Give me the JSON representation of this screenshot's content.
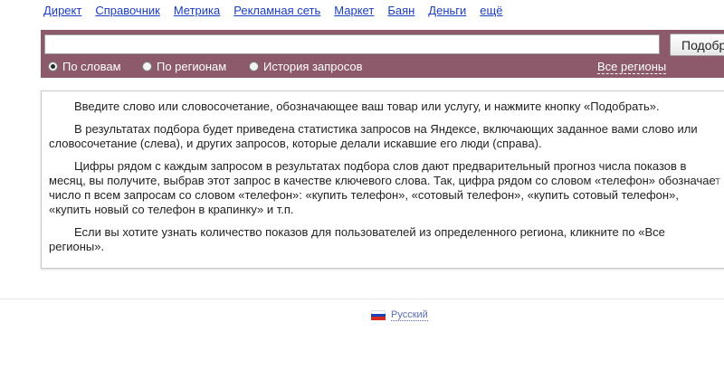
{
  "nav": {
    "items": [
      {
        "label": "Директ"
      },
      {
        "label": "Справочник"
      },
      {
        "label": "Метрика"
      },
      {
        "label": "Рекламная сеть"
      },
      {
        "label": "Маркет"
      },
      {
        "label": "Баян"
      },
      {
        "label": "Деньги"
      },
      {
        "label": "ещё"
      }
    ]
  },
  "search": {
    "input_value": "",
    "button_label": "Подобрать"
  },
  "modes": {
    "selected": "by_words",
    "items": [
      {
        "label": "По словам"
      },
      {
        "label": "По регионам"
      },
      {
        "label": "История запросов"
      }
    ]
  },
  "regions_link": "Все регионы",
  "info": {
    "paragraphs": [
      "Введите слово или словосочетание, обозначающее ваш товар или услугу, и нажмите кнопку «Подобрать».",
      "В результатах подбора будет приведена статистика запросов на Яндексе, включающих заданное вами слово или словосочетание (слева), и других запросов, которые делали искавшие его люди (справа).",
      "Цифры рядом с каждым запросом в результатах подбора слов дают предварительный прогноз числа показов в месяц, вы получите, выбрав этот запрос в качестве ключевого слова. Так, цифра рядом со словом «телефон» обозначает число п всем запросам со словом «телефон»: «купить телефон», «сотовый телефон», «купить сотовый телефон», «купить новый со телефон в крапинку» и т.п.",
      "Если вы хотите узнать количество показов для пользователей из определенного региона, кликните по «Все регионы»."
    ]
  },
  "footer": {
    "language": "Русский",
    "flag_icon": "russia-flag-icon"
  },
  "colors": {
    "search_bar": "#8c5a6b",
    "link": "#1a3dc1"
  }
}
